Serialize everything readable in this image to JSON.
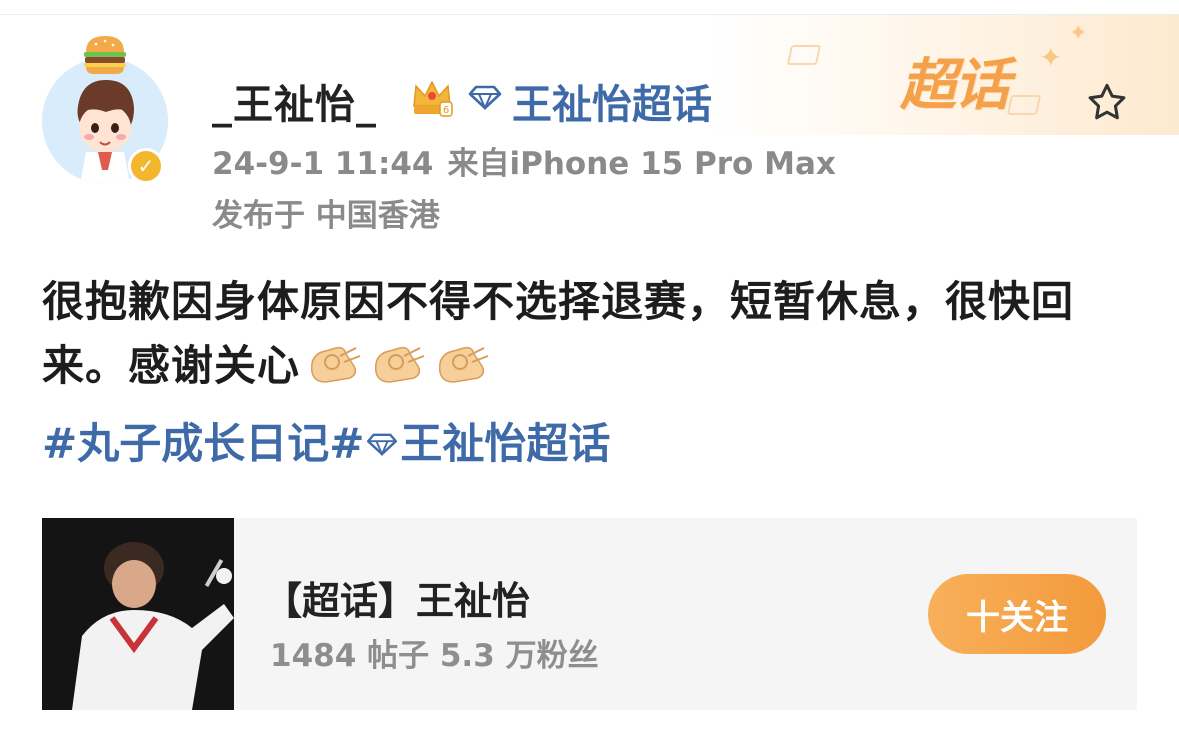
{
  "header": {
    "username": "_王祉怡_",
    "super_topic_link": "王祉怡超话",
    "timestamp": "24-9-1 11:44",
    "source": "来自iPhone 15 Pro Max",
    "location": "发布于 中国香港",
    "badge_logo": "超话",
    "icons": [
      "burger-icon",
      "verified-icon",
      "crown-icon",
      "diamond-icon",
      "star-icon"
    ]
  },
  "post": {
    "text": "很抱歉因身体原因不得不选择退赛，短暂休息，很快回来。感谢关心",
    "emoji": [
      "ok-hand-emoji",
      "ok-hand-emoji",
      "ok-hand-emoji"
    ],
    "hashtag_1": "#丸子成长日记#",
    "hashtag_2": "王祉怡超话"
  },
  "card": {
    "title": "【超话】王祉怡",
    "stats": "1484 帖子 5.3 万粉丝",
    "follow_label": "十关注"
  },
  "colors": {
    "link": "#3f6aa8",
    "accent_orange": "#f5a04a",
    "verified_gold": "#f3b72e"
  }
}
